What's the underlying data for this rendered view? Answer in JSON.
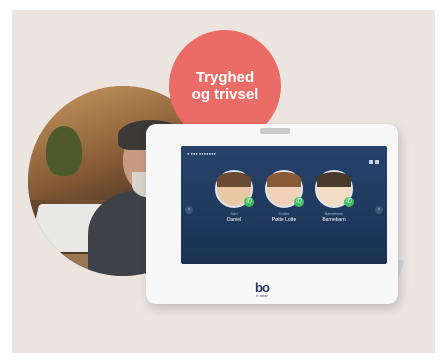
{
  "badge": {
    "line1": "Tryghed",
    "line2": "og trivsel"
  },
  "screen": {
    "contacts": [
      {
        "relation": "Søn",
        "name": "Daniel",
        "call_icon": "phone-icon"
      },
      {
        "relation": "Datter",
        "name": "Pøtte Lotte",
        "call_icon": "phone-icon"
      },
      {
        "relation": "Barnebarn",
        "name": "Barnebarn",
        "call_icon": "phone-icon"
      }
    ]
  },
  "logo": {
    "mark": "bo",
    "text": "b-near"
  },
  "colors": {
    "badge": "#eb6b66",
    "screen": "#27436b",
    "call": "#3fbf5f",
    "background": "#ece4df"
  }
}
